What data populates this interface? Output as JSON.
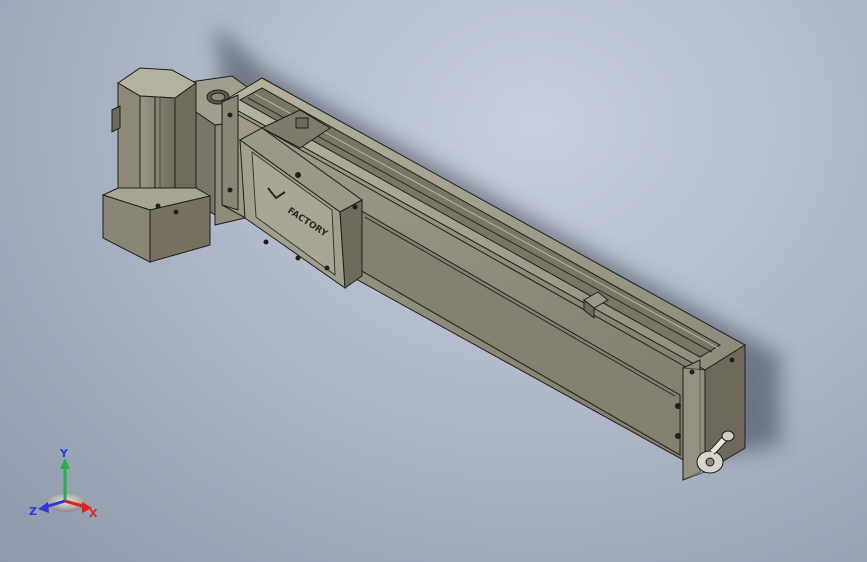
{
  "model": {
    "carriage_brand": "FACTORY",
    "colors": {
      "body": "#8f8a78",
      "body_dark": "#6d6a5c",
      "body_light": "#a9a593",
      "edge": "#1f1f1c",
      "background_top": "#c8d0de",
      "background_bottom": "#8e99ab"
    }
  },
  "triad": {
    "x_label": "X",
    "y_label": "Y",
    "z_label": "Z",
    "x_color": "#e2231a",
    "y_color": "#24b14a",
    "z_color": "#2a3bd6"
  }
}
